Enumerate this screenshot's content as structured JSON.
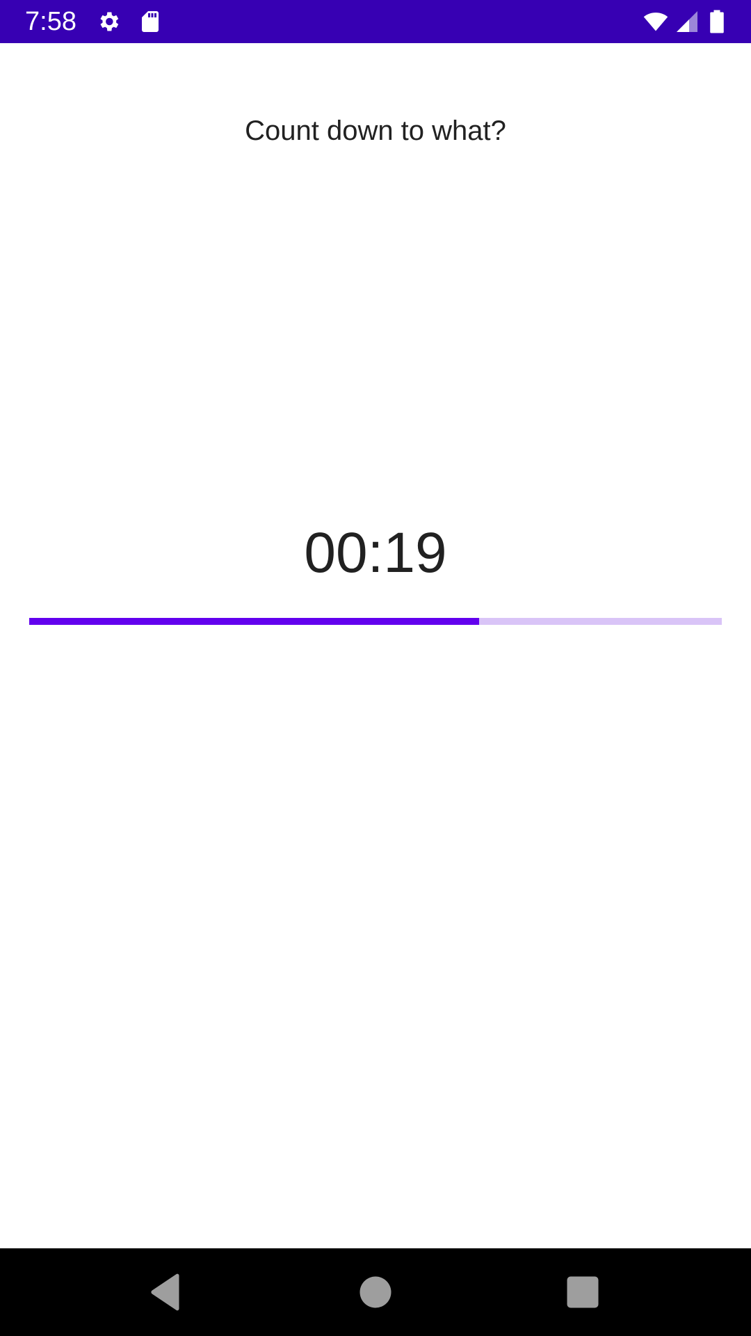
{
  "status_bar": {
    "time": "7:58",
    "background": "#3700b3",
    "icons": [
      "settings-icon",
      "sd-card-icon",
      "wifi-icon",
      "cell-signal-icon",
      "battery-icon"
    ]
  },
  "main": {
    "prompt": "Count down to what?",
    "timer": "00:19",
    "progress": {
      "fraction": 0.65,
      "fill_color": "#6200ee",
      "track_color": "#d9c4f7"
    }
  },
  "nav_bar": {
    "icons": [
      "back-icon",
      "home-icon",
      "recents-icon"
    ]
  }
}
